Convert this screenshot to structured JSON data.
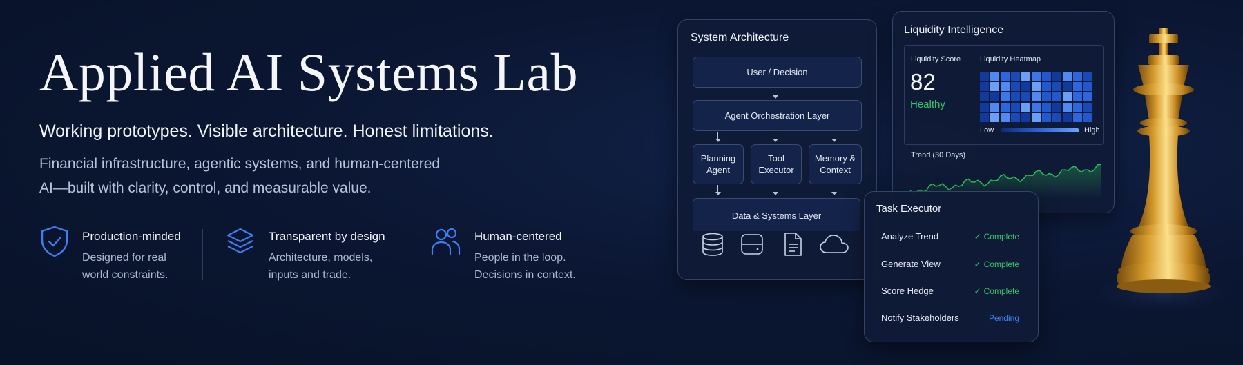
{
  "hero": {
    "title": "Applied AI Systems Lab",
    "subtitle": "Working prototypes. Visible architecture. Honest limitations.",
    "description_line1": "Financial infrastructure, agentic systems, and human-centered",
    "description_line2": "AI—built with clarity, control, and measurable value."
  },
  "features": [
    {
      "icon": "shield-check-icon",
      "title": "Production-minded",
      "line1": "Designed for real",
      "line2": "world constraints."
    },
    {
      "icon": "layers-icon",
      "title": "Transparent by design",
      "line1": "Architecture, models,",
      "line2": "inputs and trade."
    },
    {
      "icon": "people-icon",
      "title": "Human-centered",
      "line1": "People in the loop.",
      "line2": "Decisions in context."
    }
  ],
  "architecture": {
    "title": "System Architecture",
    "user_node": "User / Decision",
    "orchestration_node": "Agent Orchestration Layer",
    "planning_line1": "Planning",
    "planning_line2": "Agent",
    "tool_line1": "Tool",
    "tool_line2": "Executor",
    "memory_line1": "Memory &",
    "memory_line2": "Context",
    "data_node": "Data & Systems Layer",
    "icons": [
      "database-icon",
      "server-icon",
      "document-icon",
      "cloud-icon"
    ]
  },
  "liquidity": {
    "title": "Liquidity Intelligence",
    "score_label": "Liquidity Score",
    "score_value": "82",
    "score_status": "Healthy",
    "heatmap_label": "Liquidity Heatmap",
    "legend_low": "Low",
    "legend_high": "High",
    "trend_label": "Trend (30 Days)",
    "colors": {
      "healthy": "#35c46a",
      "heatmap_low": "#0d2a7a",
      "heatmap_high": "#6aa4ff",
      "trend_line": "#2fbf5a"
    }
  },
  "tasks": {
    "title": "Task Executor",
    "items": [
      {
        "name": "Analyze Trend",
        "status": "Complete",
        "state": "complete"
      },
      {
        "name": "Generate View",
        "status": "Complete",
        "state": "complete"
      },
      {
        "name": "Score Hedge",
        "status": "Complete",
        "state": "complete"
      },
      {
        "name": "Notify Stakeholders",
        "status": "Pending",
        "state": "pending"
      }
    ],
    "colors": {
      "complete": "#35c46a",
      "pending": "#3b82f6"
    }
  },
  "decor": {
    "chess_piece": "king-chess-piece-icon"
  }
}
